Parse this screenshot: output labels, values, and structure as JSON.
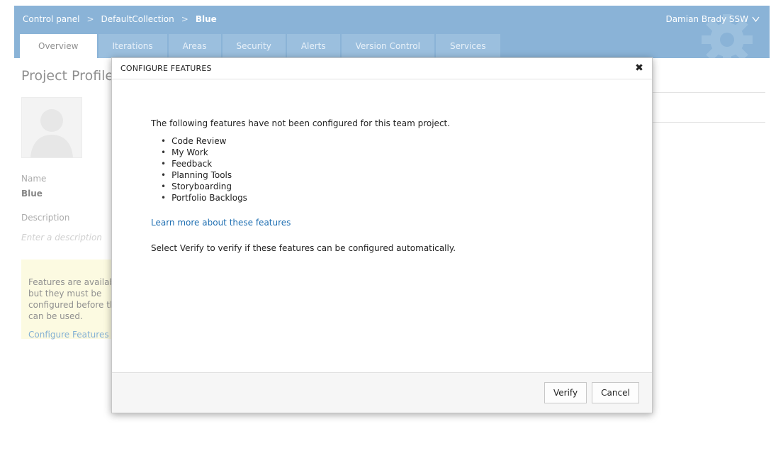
{
  "breadcrumb": {
    "items": [
      "Control panel",
      "DefaultCollection",
      "Blue"
    ],
    "separator": ">"
  },
  "user": {
    "name": "Damian Brady SSW",
    "menu_icon": "chevron-down-icon"
  },
  "tabs": [
    {
      "label": "Overview",
      "active": true
    },
    {
      "label": "Iterations",
      "active": false
    },
    {
      "label": "Areas",
      "active": false
    },
    {
      "label": "Security",
      "active": false
    },
    {
      "label": "Alerts",
      "active": false
    },
    {
      "label": "Version Control",
      "active": false
    },
    {
      "label": "Services",
      "active": false
    }
  ],
  "profile": {
    "title": "Project Profile",
    "name_label": "Name",
    "name_value": "Blue",
    "description_label": "Description",
    "description_placeholder": "Enter a description"
  },
  "features_notice": {
    "message": "Features are available but they must be configured before they can be used.",
    "link": "Configure Features"
  },
  "dialog": {
    "title": "CONFIGURE FEATURES",
    "close_icon": "close-icon",
    "intro": "The following features have not been configured for this team project.",
    "features": [
      "Code Review",
      "My Work",
      "Feedback",
      "Planning Tools",
      "Storyboarding",
      "Portfolio Backlogs"
    ],
    "learn_more": "Learn more about these features",
    "verify_text": "Select Verify to verify if these features can be configured automatically.",
    "verify_button": "Verify",
    "cancel_button": "Cancel"
  },
  "colors": {
    "header": "#2a76b7",
    "tab": "#4a8bc4",
    "link": "#1f6fb2",
    "notice_bg": "#f9f6c8"
  }
}
